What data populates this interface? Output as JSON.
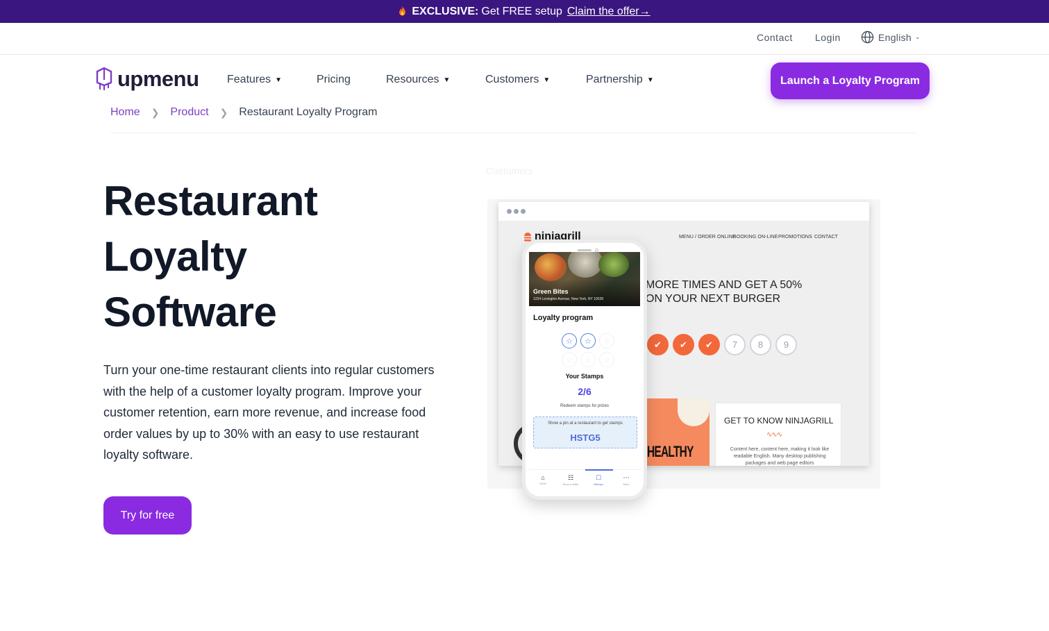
{
  "promo": {
    "exclusive": "EXCLUSIVE:",
    "text": "Get FREE setup",
    "claim": "Claim the offer→"
  },
  "utility": {
    "contact": "Contact",
    "login": "Login",
    "language": "English"
  },
  "logo": {
    "text": "upmenu"
  },
  "nav": {
    "items": [
      {
        "label": "Features",
        "dropdown": true
      },
      {
        "label": "Pricing",
        "dropdown": false
      },
      {
        "label": "Resources",
        "dropdown": true
      },
      {
        "label": "Customers",
        "dropdown": true
      },
      {
        "label": "Partnership",
        "dropdown": true
      }
    ],
    "cta": "Launch a Loyalty Program"
  },
  "breadcrumb": {
    "home": "Home",
    "product": "Product",
    "current": "Restaurant Loyalty Program"
  },
  "hero": {
    "title_line1": "Restaurant",
    "title_line2": "Loyalty",
    "title_line3": "Software",
    "description": "Turn your one-time restaurant clients into regular customers with the help of a customer loyalty program. Improve your customer retention, earn more revenue, and increase food order values by up to 30% with an easy to use restaurant loyalty software.",
    "cta": "Try for free"
  },
  "illustration": {
    "ghost_label": "Customers",
    "site": {
      "logo": "ninjagrill",
      "nav": [
        "MENU / ORDER ONLINE",
        "BOOKING ON-LINE",
        "PROMOTIONS",
        "CONTACT"
      ],
      "headline_line1": "MORE TIMES AND GET A 50%",
      "headline_line2": "ON YOUR NEXT BURGER",
      "stamps": [
        {
          "label": "✔",
          "done": true
        },
        {
          "label": "✔",
          "done": true
        },
        {
          "label": "✔",
          "done": true
        },
        {
          "label": "7",
          "done": false
        },
        {
          "label": "8",
          "done": false
        },
        {
          "label": "9",
          "done": false
        }
      ],
      "healthy": "HEALTHY",
      "card_title": "GET TO KNOW NINJAGRILL",
      "card_body": "Content here, content here, making it look like readable English. Many desktop publishing packages and web page editors"
    },
    "phone": {
      "restaurant": "Green Bites",
      "address": "1234 Lexington Avenue, New York, NY 10028",
      "loyalty_title": "Loyalty program",
      "your_stamps": "Your Stamps",
      "count": "2/6",
      "redeem": "Redeem stamps for prizes",
      "pin_text": "Show a pin at a restaurant to get stamps",
      "pin_code": "HSTG5",
      "tabs": [
        {
          "icon": "⌂",
          "label": "Order"
        },
        {
          "icon": "☷",
          "label": "Book a table"
        },
        {
          "icon": "☐",
          "label": "Stamps"
        },
        {
          "icon": "⋯",
          "label": "More"
        }
      ]
    }
  },
  "colors": {
    "brand_purple": "#8a2be2",
    "promo_bg": "#3a1680",
    "stamp_orange": "#f2683a"
  }
}
